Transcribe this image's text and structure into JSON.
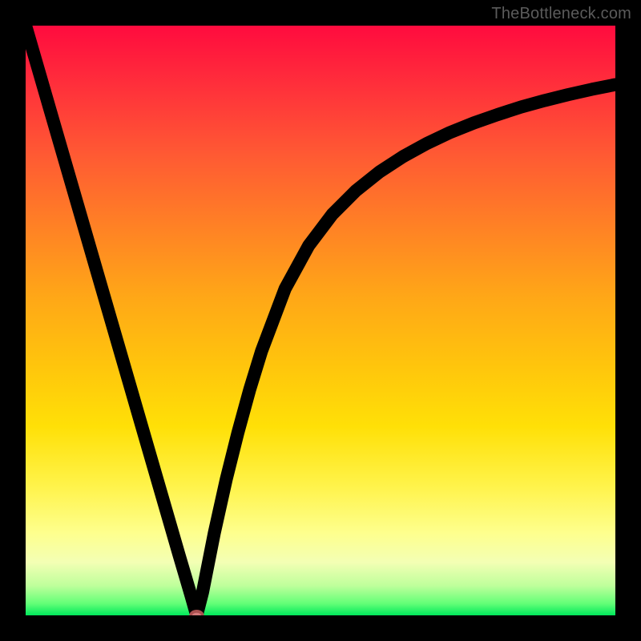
{
  "watermark": "TheBottleneck.com",
  "chart_data": {
    "type": "line",
    "title": "",
    "xlabel": "",
    "ylabel": "",
    "xlim": [
      0,
      100
    ],
    "ylim": [
      0,
      100
    ],
    "grid": false,
    "series": [
      {
        "name": "curve",
        "x": [
          0,
          2,
          4,
          6,
          8,
          10,
          12,
          14,
          16,
          18,
          20,
          22,
          24,
          26,
          27,
          28,
          29,
          30,
          32,
          34,
          36,
          38,
          40,
          44,
          48,
          52,
          56,
          60,
          64,
          68,
          72,
          76,
          80,
          84,
          88,
          92,
          96,
          100
        ],
        "y": [
          100,
          93.1,
          86.2,
          79.3,
          72.4,
          65.5,
          58.6,
          51.7,
          44.8,
          37.9,
          31.0,
          24.1,
          17.2,
          10.3,
          6.9,
          3.5,
          0,
          3.9,
          14.0,
          23.0,
          31.0,
          38.3,
          44.8,
          55.4,
          62.7,
          68.0,
          72.0,
          75.2,
          77.8,
          80.0,
          81.9,
          83.5,
          84.9,
          86.2,
          87.3,
          88.3,
          89.2,
          90.0
        ]
      }
    ],
    "marker": {
      "x": 29,
      "y": 0
    }
  },
  "colors": {
    "frame": "#000000",
    "curve": "#000000",
    "marker_fill": "#d47a7a",
    "marker_stroke": "#aa5050"
  }
}
